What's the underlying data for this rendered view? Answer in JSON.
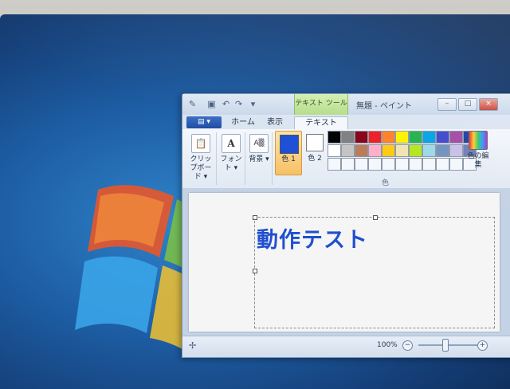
{
  "window": {
    "title": "無題 - ペイント",
    "context_tab": "テキスト ツール",
    "controls": {
      "minimize": "–",
      "maximize": "□",
      "close": "×"
    }
  },
  "tabs": {
    "file": "▤ ▾",
    "items": [
      {
        "label": "ホーム"
      },
      {
        "label": "表示"
      },
      {
        "label": "テキスト"
      }
    ],
    "active": "テキスト"
  },
  "ribbon": {
    "clipboard": "クリップボード ▾",
    "font": "フォント ▾",
    "background": "背景 ▾",
    "color1": "色 1",
    "color2": "色 2",
    "edit_colors": "色の編集",
    "colors_group": "色",
    "selected_color1": "#1d4fd8",
    "selected_color2": "#ffffff",
    "palette_row1": [
      "#000000",
      "#7f7f7f",
      "#880015",
      "#ed1c24",
      "#ff7f27",
      "#fff200",
      "#22b14c",
      "#00a2e8",
      "#3f48cc",
      "#a349a4",
      "#1f3f9f"
    ],
    "palette_row2": [
      "#ffffff",
      "#c3c3c3",
      "#b97a57",
      "#ffaec9",
      "#ffc90e",
      "#efe4b0",
      "#b5e61d",
      "#99d9ea",
      "#7092be",
      "#c8bfe7",
      "#6e7fb5"
    ]
  },
  "canvas": {
    "text": "動作テスト",
    "text_color": "#1f4fd0"
  },
  "status": {
    "zoom": "100%",
    "zoom_out": "−",
    "zoom_in": "+"
  }
}
